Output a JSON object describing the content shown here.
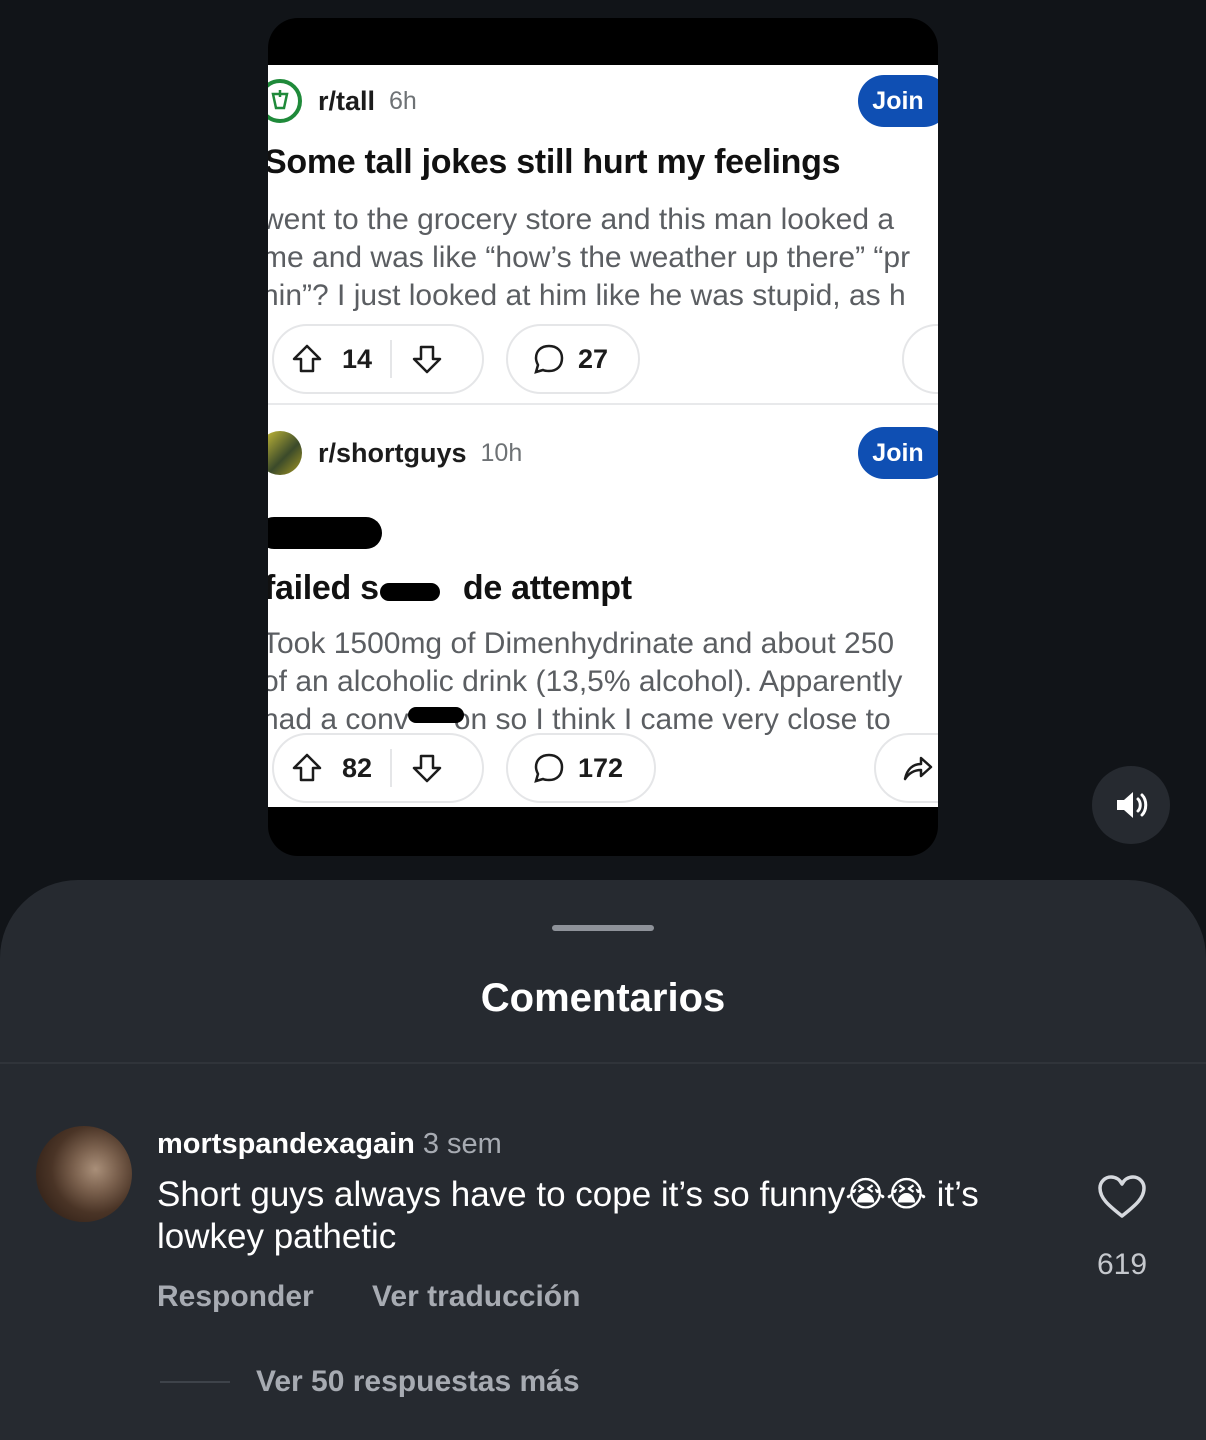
{
  "media": {
    "posts": [
      {
        "subreddit": "r/tall",
        "time": "6h",
        "join_label": "Join",
        "title": "Some tall jokes still hurt my feelings",
        "body_lines": [
          " went to the grocery store and this man looked a",
          "me and was like “how’s the weather up there” “pr",
          "hin”? I just looked at him like he was stupid, as h"
        ],
        "upvotes": "14",
        "comments": "27"
      },
      {
        "subreddit": "r/shortguys",
        "time": "10h",
        "join_label": "Join",
        "title": "failed s   de attempt",
        "body_lines": [
          "Took 1500mg of Dimenhydrinate and about 250",
          "of an alcoholic drink (13,5% alcohol). Apparently",
          "had a conv  on so I think I came very close to"
        ],
        "upvotes": "82",
        "comments": "172"
      }
    ]
  },
  "sound_button": {
    "icon": "speaker-icon"
  },
  "comments_sheet": {
    "title": "Comentarios",
    "comment": {
      "username": "mortspandexagain",
      "time": "3 sem",
      "text": "Short guys always have to cope it’s so funny😭😭 it’s lowkey pathetic",
      "reply_label": "Responder",
      "translate_label": "Ver traducción",
      "likes": "619",
      "more_replies": "Ver 50 respuestas más"
    }
  }
}
